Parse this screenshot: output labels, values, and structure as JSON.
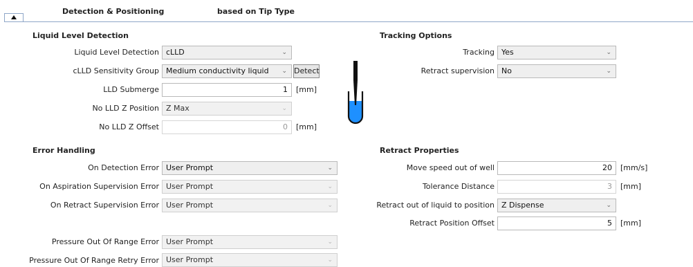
{
  "header": {
    "title": "Detection & Positioning",
    "subtitle": "based on Tip Type"
  },
  "lld": {
    "section": "Liquid Level Detection",
    "detection_label": "Liquid Level Detection",
    "detection_value": "cLLD",
    "sensitivity_label": "cLLD Sensitivity Group",
    "sensitivity_value": "Medium conductivity liquid",
    "detect_button": "Detect",
    "submerge_label": "LLD Submerge",
    "submerge_value": "1",
    "submerge_unit": "[mm]",
    "nolld_z_label": "No LLD Z Position",
    "nolld_z_value": "Z Max",
    "nolld_offset_label": "No LLD Z Offset",
    "nolld_offset_value": "0",
    "nolld_offset_unit": "[mm]"
  },
  "tracking": {
    "section": "Tracking Options",
    "tracking_label": "Tracking",
    "tracking_value": "Yes",
    "retract_sup_label": "Retract supervision",
    "retract_sup_value": "No"
  },
  "errors": {
    "section": "Error Handling",
    "on_detection_label": "On Detection Error",
    "on_detection_value": "User Prompt",
    "on_aspiration_label": "On Aspiration Supervision Error",
    "on_aspiration_value": "User Prompt",
    "on_retract_label": "On Retract Supervision Error",
    "on_retract_value": "User Prompt",
    "pressure_label": "Pressure Out Of Range Error",
    "pressure_value": "User Prompt",
    "pressure_retry_label": "Pressure Out Of Range Retry Error",
    "pressure_retry_value": "User Prompt"
  },
  "retract": {
    "section": "Retract Properties",
    "speed_label": "Move speed out of well",
    "speed_value": "20",
    "speed_unit": "[mm/s]",
    "tolerance_label": "Tolerance Distance",
    "tolerance_value": "3",
    "tolerance_unit": "[mm]",
    "position_label": "Retract out of liquid to position",
    "position_value": "Z Dispense",
    "offset_label": "Retract Position Offset",
    "offset_value": "5",
    "offset_unit": "[mm]"
  },
  "icons": {
    "collapse": "triangle-up-icon",
    "tube": "tip-in-tube-icon",
    "chevron": "chevron-down-icon"
  },
  "colors": {
    "liquid": "#1e90ff",
    "rule": "#8ea6c8"
  }
}
